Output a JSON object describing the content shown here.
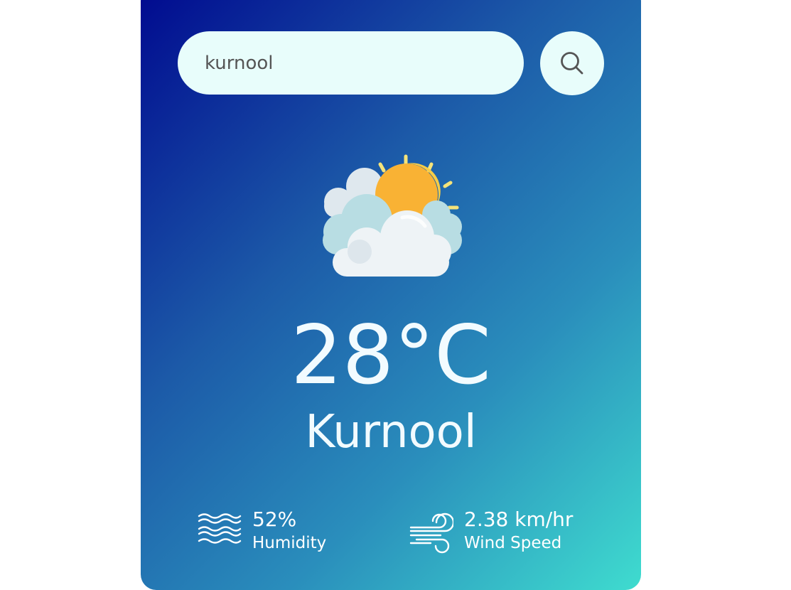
{
  "search": {
    "value": "kurnool"
  },
  "weather": {
    "condition_icon": "partly-cloudy-sun-icon",
    "temperature": "28°C",
    "city": "Kurnool"
  },
  "details": {
    "humidity": {
      "value": "52%",
      "label": "Humidity",
      "icon": "humidity-waves-icon"
    },
    "wind": {
      "value": "2.38 km/hr",
      "label": "Wind Speed",
      "icon": "wind-icon"
    }
  },
  "colors": {
    "gradient_start": "#00098f",
    "gradient_end": "#3fdccf",
    "input_bg": "#e8fdfb",
    "text": "#f2fbff"
  }
}
